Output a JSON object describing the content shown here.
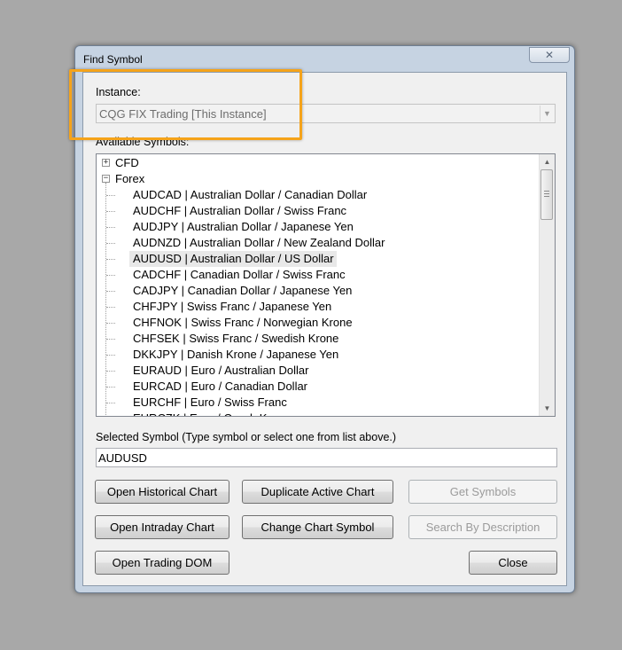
{
  "window": {
    "title": "Find Symbol",
    "close_glyph": "✕"
  },
  "instance": {
    "label": "Instance:",
    "value": "CQG FIX Trading [This Instance]"
  },
  "available": {
    "label": "Available Symbols:"
  },
  "tree": {
    "groups": [
      {
        "label": "CFD",
        "expander": "+",
        "expanded": false
      },
      {
        "label": "Forex",
        "expander": "−",
        "expanded": true
      }
    ],
    "forex_items": [
      "AUDCAD  |  Australian Dollar / Canadian Dollar",
      "AUDCHF  |  Australian Dollar / Swiss Franc",
      "AUDJPY  |  Australian Dollar / Japanese Yen",
      "AUDNZD  |  Australian Dollar / New Zealand Dollar",
      "AUDUSD  |  Australian Dollar / US Dollar",
      "CADCHF  |  Canadian Dollar / Swiss Franc",
      "CADJPY  |  Canadian Dollar / Japanese Yen",
      "CHFJPY  |  Swiss Franc / Japanese Yen",
      "CHFNOK  |  Swiss Franc / Norwegian Krone",
      "CHFSEK  |  Swiss Franc / Swedish Krone",
      "DKKJPY  |  Danish Krone / Japanese Yen",
      "EURAUD  |  Euro / Australian Dollar",
      "EURCAD  |  Euro / Canadian Dollar",
      "EURCHF  |  Euro / Swiss Franc",
      "EURCZK  |  Euro / Czech Koruna"
    ],
    "selected_item": "AUDUSD  |  Australian Dollar / US Dollar"
  },
  "selected_symbol": {
    "label": "Selected Symbol (Type symbol or select one from list above.)",
    "value": "AUDUSD"
  },
  "buttons": {
    "open_historical": "Open Historical Chart",
    "duplicate_active": "Duplicate Active Chart",
    "get_symbols": "Get Symbols",
    "open_intraday": "Open Intraday Chart",
    "change_symbol": "Change Chart Symbol",
    "search_description": "Search By Description",
    "open_dom": "Open Trading DOM",
    "close": "Close"
  },
  "colors": {
    "highlight": "#f5a31a",
    "selected_row": "#e8e8e8",
    "disabled_text": "#9b9b9b"
  }
}
